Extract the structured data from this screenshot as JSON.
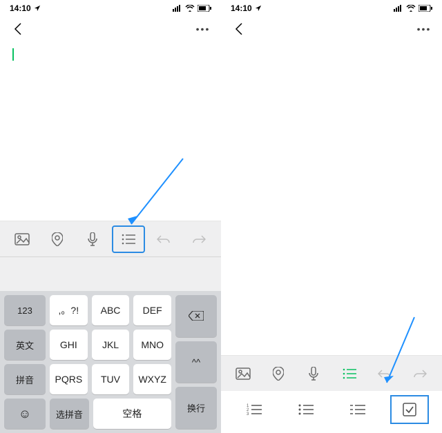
{
  "status": {
    "time": "14:10"
  },
  "nav": {
    "more": "•••"
  },
  "toolbar_left": {
    "items": [
      "image",
      "location",
      "mic",
      "list",
      "undo",
      "redo"
    ]
  },
  "toolbar_right": {
    "items": [
      "image",
      "location",
      "mic",
      "list",
      "undo",
      "redo"
    ]
  },
  "subtoolbar": {
    "items": [
      "num-list",
      "bullet-list",
      "dash-list",
      "checklist"
    ]
  },
  "keyboard": {
    "side_left": [
      "123",
      "英文",
      "拼音"
    ],
    "mid": [
      [
        ",。?!",
        "ABC",
        "DEF"
      ],
      [
        "GHI",
        "JKL",
        "MNO"
      ],
      [
        "PQRS",
        "TUV",
        "WXYZ"
      ],
      [
        "选拼音",
        "空格"
      ]
    ],
    "side_right_top": "⌫",
    "side_right_mid": "^^",
    "side_right_bottom": "换行",
    "emoji": "☺"
  }
}
